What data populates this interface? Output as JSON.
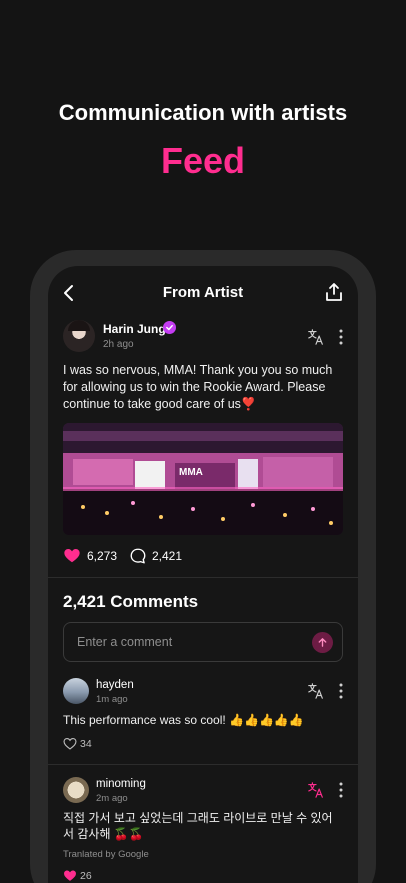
{
  "hero": {
    "subtitle": "Communication with artists",
    "title": "Feed"
  },
  "nav": {
    "title": "From Artist"
  },
  "post": {
    "author": "Harin Jung",
    "time": "2h ago",
    "text": "I was so nervous, MMA! Thank you you so much for allowing us to win the Rookie Award. Please continue to take good care of us❣️",
    "image_sign": "MMA",
    "likes": "6,273",
    "comments": "2,421"
  },
  "comments_section": {
    "heading": "2,421 Comments",
    "input_placeholder": "Enter a comment",
    "items": [
      {
        "user": "hayden",
        "time": "1m ago",
        "text": "This performance was so cool! 👍👍👍👍👍",
        "likes": "34"
      },
      {
        "user": "minoming",
        "time": "2m ago",
        "text": "직접 가서 보고 싶었는데 그래도 라이브로 만날 수 있어서 감사해 🍒🍒",
        "translated_note": "Tranlated by Google",
        "likes": "26"
      }
    ]
  },
  "colors": {
    "accent_pink": "#ff2d8f",
    "verified_purple": "#c43cf2",
    "background": "#141414"
  },
  "icons": [
    "back-arrow",
    "share",
    "verified-badge",
    "translate",
    "more-vertical",
    "heart",
    "comment-bubble",
    "send-arrow"
  ]
}
